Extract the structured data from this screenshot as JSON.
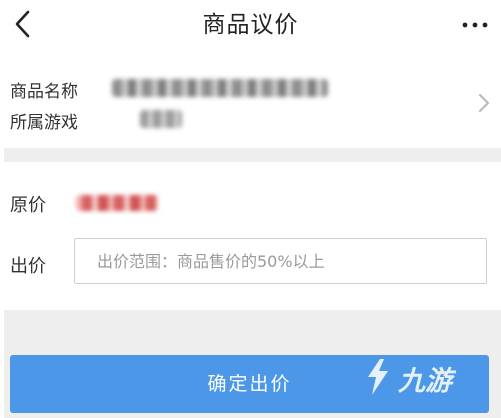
{
  "header": {
    "title": "商品议价",
    "back_icon": "chevron-left-icon",
    "more_icon": "more-horizontal-icon"
  },
  "product": {
    "name_label": "商品名称",
    "game_label": "所属游戏",
    "chevron_icon": "chevron-right-icon"
  },
  "pricing": {
    "original_label": "原价",
    "bid_label": "出价",
    "bid_placeholder": "出价范围：商品售价的50%以上",
    "bid_value": ""
  },
  "footer": {
    "confirm_label": "确定出价"
  },
  "watermark": {
    "text": "九游",
    "logo_icon": "jiuyou-logo-icon"
  },
  "colors": {
    "accent": "#4c97e8",
    "separator": "#eeeeee",
    "price_blur": "#e58a8a"
  }
}
